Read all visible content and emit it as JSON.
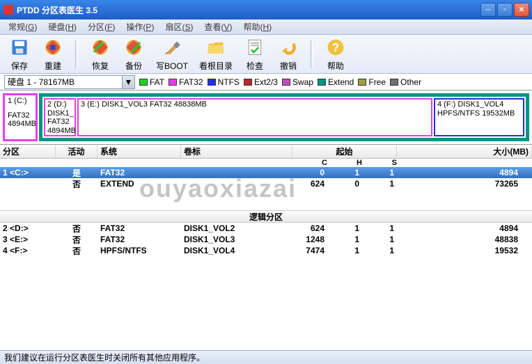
{
  "title": "PTDD 分区表医生 3.5",
  "menus": [
    {
      "label": "常规",
      "key": "G"
    },
    {
      "label": "硬盘",
      "key": "H"
    },
    {
      "label": "分区",
      "key": "F"
    },
    {
      "label": "操作",
      "key": "P"
    },
    {
      "label": "扇区",
      "key": "S"
    },
    {
      "label": "查看",
      "key": "V"
    },
    {
      "label": "帮助",
      "key": "H"
    }
  ],
  "toolbar": [
    {
      "name": "save",
      "label": "保存"
    },
    {
      "name": "rebuild",
      "label": "重建"
    },
    {
      "name": "restore",
      "label": "恢复"
    },
    {
      "name": "backup",
      "label": "备份"
    },
    {
      "name": "writeboot",
      "label": "写BOOT"
    },
    {
      "name": "rootdir",
      "label": "看根目录"
    },
    {
      "name": "check",
      "label": "检查"
    },
    {
      "name": "undo",
      "label": "撤销"
    },
    {
      "name": "help",
      "label": "帮助"
    }
  ],
  "driveSelect": "硬盘 1 - 78167MB",
  "legend": [
    {
      "label": "FAT",
      "color": "#1fd41f"
    },
    {
      "label": "FAT32",
      "color": "#e83de8"
    },
    {
      "label": "NTFS",
      "color": "#2030e0"
    },
    {
      "label": "Ext2/3",
      "color": "#b32a2a"
    },
    {
      "label": "Swap",
      "color": "#bf4fbf"
    },
    {
      "label": "Extend",
      "color": "#009484"
    },
    {
      "label": "Free",
      "color": "#a0a040"
    },
    {
      "label": "Other",
      "color": "#707070"
    }
  ],
  "diskmap": {
    "c": {
      "drive": "1 (C:)",
      "fs": "FAT32",
      "size": "4894MB"
    },
    "d": {
      "drive": "2 (D:)",
      "vol": "DISK1_",
      "fs": "FAT32",
      "size": "4894MB"
    },
    "e": {
      "drive": "3 (E:)",
      "vol": "DISK1_VOL3",
      "fs": "FAT32",
      "size": "48838MB"
    },
    "f": {
      "drive": "4 (F:)",
      "vol": "DISK1_VOL4",
      "fs": "HPFS/NTFS",
      "size": "19532MB"
    }
  },
  "columns": {
    "part": "分区",
    "active": "活动",
    "system": "系统",
    "label": "卷标",
    "start": "起始",
    "c": "C",
    "h": "H",
    "s": "S",
    "size": "大小(MB)"
  },
  "primaryRows": [
    {
      "idx": "1",
      "drive": "<C:>",
      "active": "是",
      "system": "FAT32",
      "label": "",
      "c": "0",
      "h": "1",
      "s": "1",
      "size": "4894",
      "sel": true
    },
    {
      "idx": "",
      "drive": "",
      "active": "否",
      "system": "EXTEND",
      "label": "",
      "c": "624",
      "h": "0",
      "s": "1",
      "size": "73265",
      "sel": false
    }
  ],
  "logicalHeader": "逻辑分区",
  "logicalRows": [
    {
      "idx": "2",
      "drive": "<D:>",
      "active": "否",
      "system": "FAT32",
      "label": "DISK1_VOL2",
      "c": "624",
      "h": "1",
      "s": "1",
      "size": "4894"
    },
    {
      "idx": "3",
      "drive": "<E:>",
      "active": "否",
      "system": "FAT32",
      "label": "DISK1_VOL3",
      "c": "1248",
      "h": "1",
      "s": "1",
      "size": "48838"
    },
    {
      "idx": "4",
      "drive": "<F:>",
      "active": "否",
      "system": "HPFS/NTFS",
      "label": "DISK1_VOL4",
      "c": "7474",
      "h": "1",
      "s": "1",
      "size": "19532"
    }
  ],
  "status": "我们建议在运行分区表医生时关闭所有其他应用程序。",
  "watermark": "ouyaoxiazai"
}
